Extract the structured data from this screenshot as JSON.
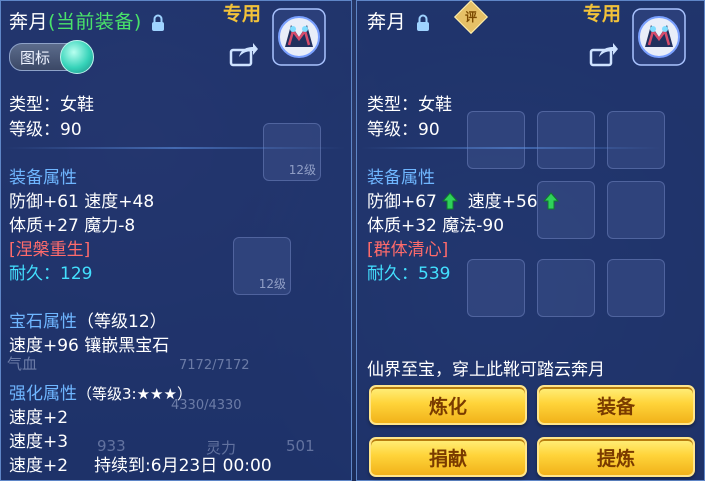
{
  "left": {
    "title": "奔月",
    "title_sub": "(当前装备)",
    "exclusive": "专用",
    "toggle_label": "图标",
    "type": "类型：女鞋",
    "level": "等级：90",
    "equip_header": "装备属性",
    "stat1": "防御+61 速度+48",
    "stat2": "体质+27 魔力-8",
    "special": "[涅槃重生]",
    "durability": "耐久：129",
    "gem_header": "宝石属性",
    "gem_level": "（等级12）",
    "gem_effect": "速度+96 镶嵌黑宝石",
    "enhance_header": "强化属性",
    "enhance_level": "（等级3:★★★）",
    "enhance1": "速度+2",
    "enhance2": "速度+3",
    "enhance3": "速度+2",
    "enhance_duration": "持续到:6月23日 00:00"
  },
  "right": {
    "title": "奔月",
    "appraise_badge": "评",
    "exclusive": "专用",
    "type": "类型：女鞋",
    "level": "等级：90",
    "equip_header": "装备属性",
    "stat1a": "防御+67",
    "stat1b": "速度+56",
    "stat2": "体质+32 魔法-90",
    "special": "[群体清心]",
    "durability": "耐久：539",
    "description": "仙界至宝，穿上此靴可踏云奔月",
    "buttons": {
      "refine": "炼化",
      "equip": "装备",
      "donate": "捐献",
      "extract": "提炼"
    }
  },
  "background": {
    "slot_level": "12级",
    "hp": "7172/7172",
    "mp": "4330/4330",
    "spirit_label": "灵力",
    "spirit_value": "501",
    "number": "933",
    "qi_label": "气血"
  },
  "colors": {
    "title_sub": "#49e36a",
    "section": "#6fb6ff",
    "special": "#ff6b6b",
    "durability": "#43e0ff",
    "exclusive": "#f2c23a",
    "button": "#ffd43a",
    "up_arrow": "#2fd15a"
  }
}
